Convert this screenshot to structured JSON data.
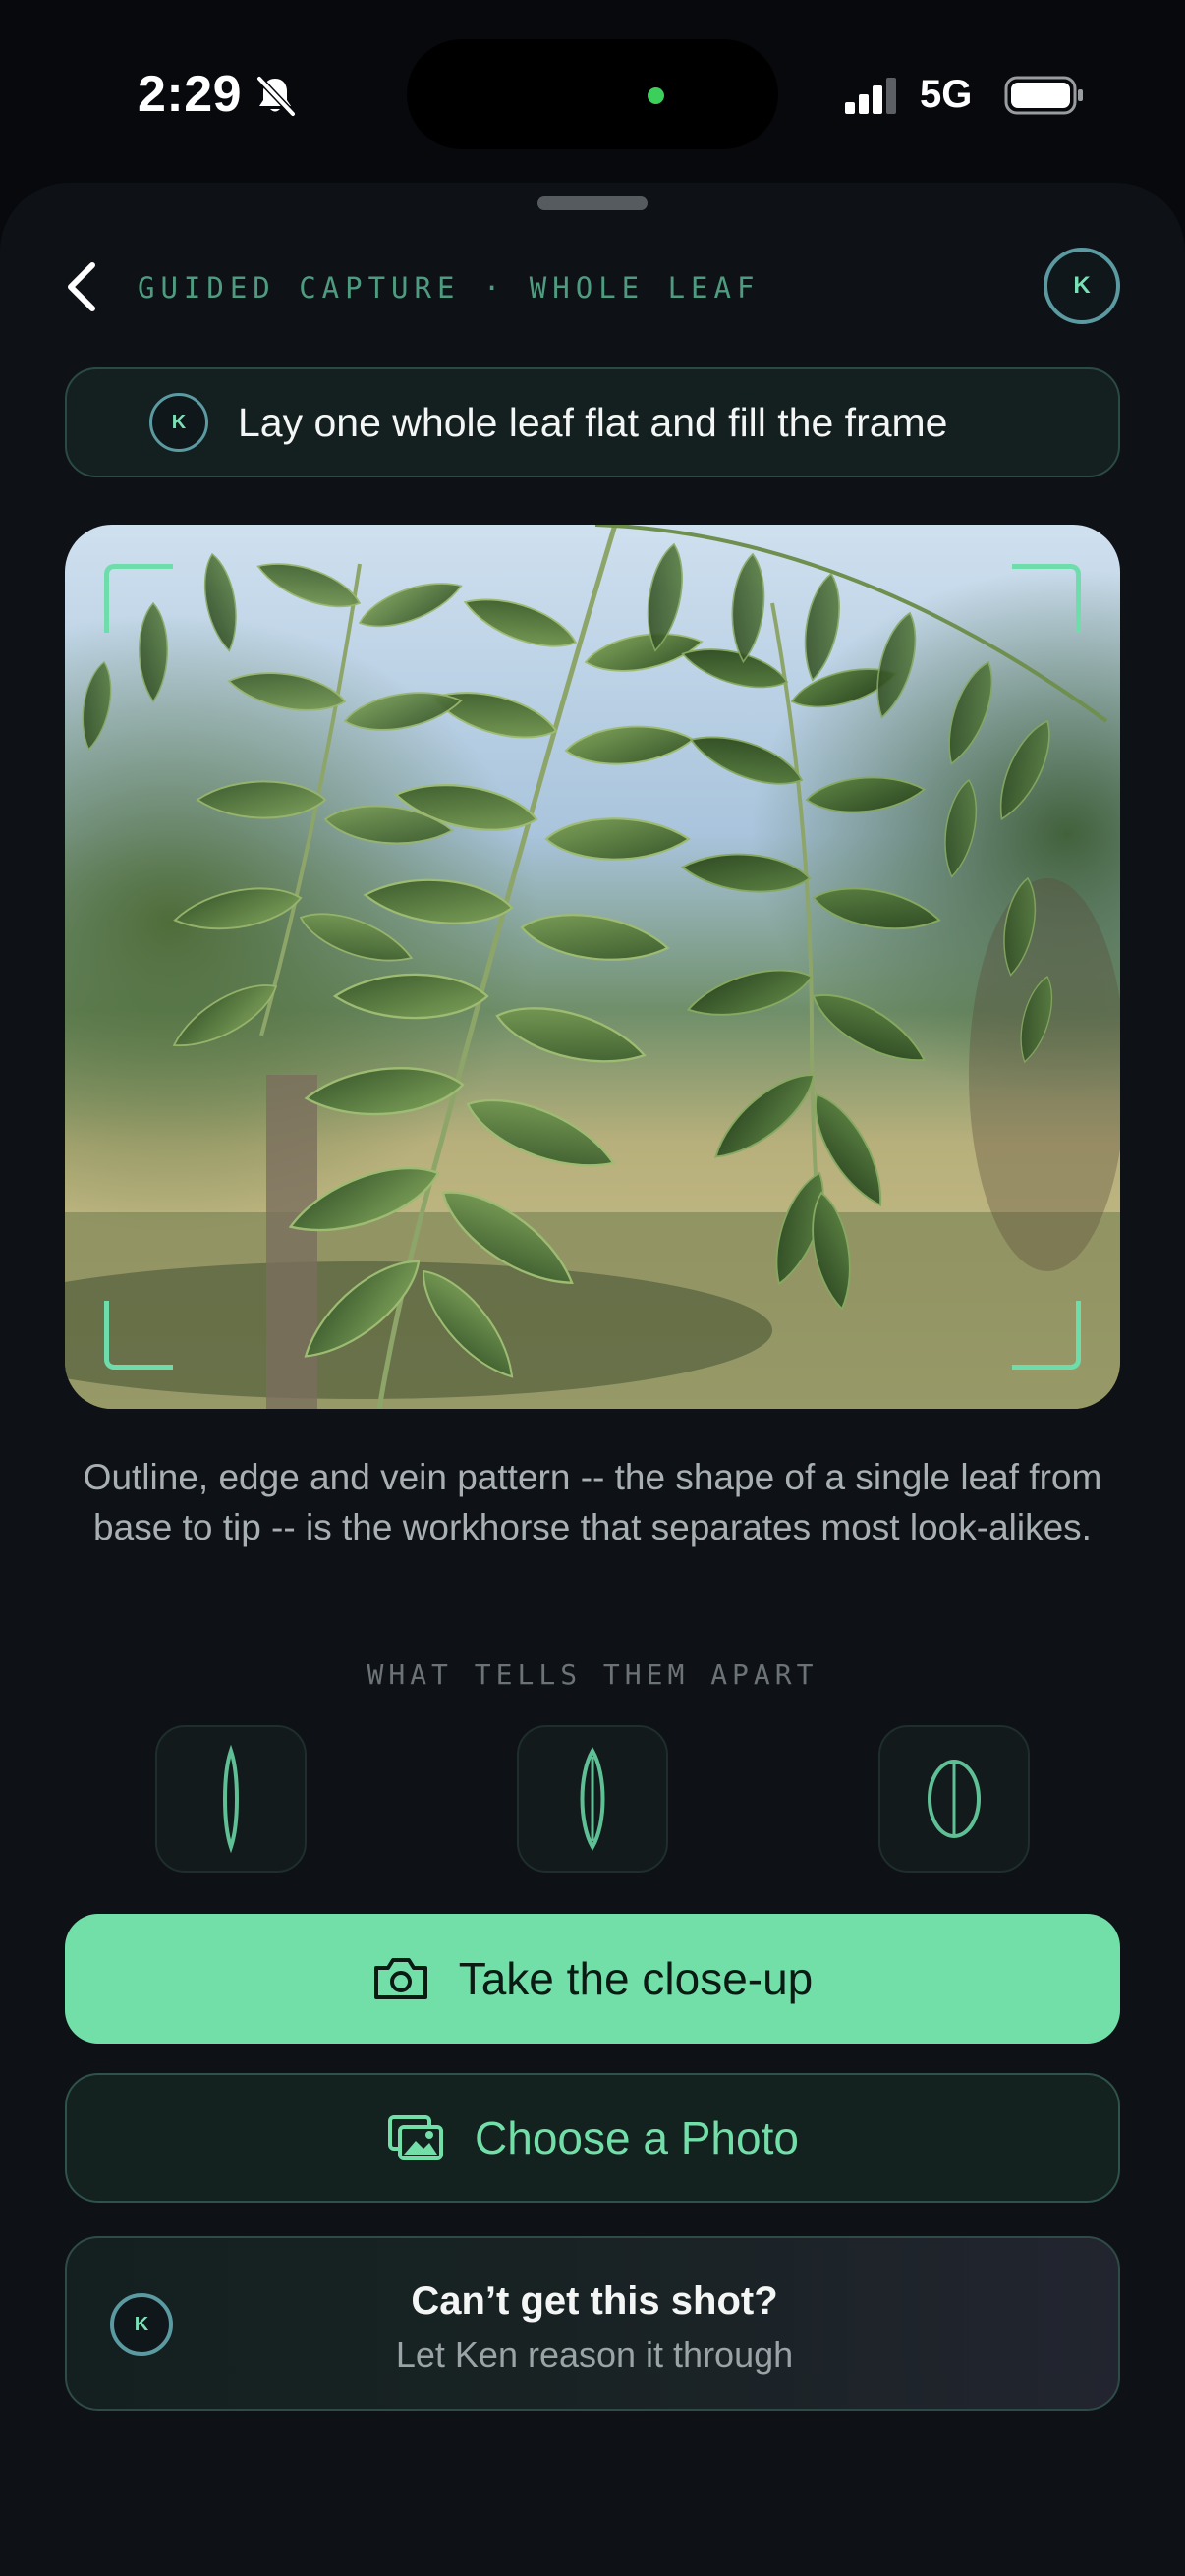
{
  "status_bar": {
    "time": "2:29",
    "network": "5G",
    "icons": [
      "bell-slash-icon",
      "signal-icon",
      "battery-icon"
    ]
  },
  "header": {
    "title": "GUIDED CAPTURE · WHOLE LEAF",
    "back_icon": "chevron-left-icon",
    "avatar_letter": "K"
  },
  "instruction": {
    "avatar_letter": "K",
    "text": "Lay one whole leaf flat and fill the frame"
  },
  "photo": {
    "subject": "leaf-photo",
    "frame_icon": "viewfinder-corners"
  },
  "description": "Outline, edge and vein pattern -- the shape of a single leaf from base to tip -- is the workhorse that separates most look-alikes.",
  "traits": {
    "label": "WHAT TELLS THEM APART",
    "items": [
      "narrow-leaf-icon",
      "lanceolate-leaf-icon",
      "oval-leaf-icon"
    ]
  },
  "actions": {
    "primary_label": "Take the close-up",
    "primary_icon": "camera-icon",
    "secondary_label": "Choose a Photo",
    "secondary_icon": "photos-icon"
  },
  "ken_card": {
    "avatar_letter": "K",
    "title": "Can’t get this shot?",
    "subtitle": "Let Ken reason it through"
  },
  "colors": {
    "accent": "#72dfa9",
    "background": "#0e1217",
    "title_green": "#4f9b80"
  }
}
